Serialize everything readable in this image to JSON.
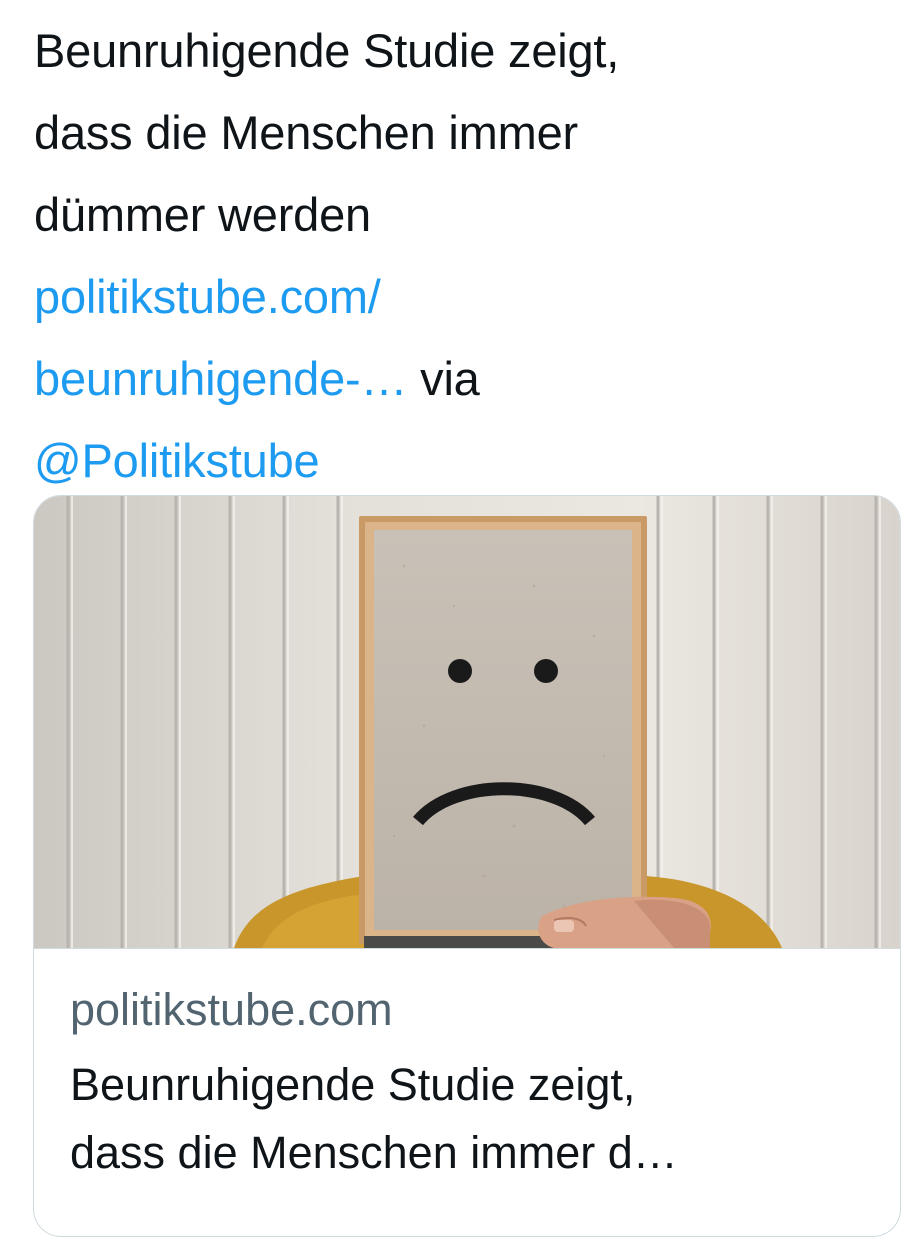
{
  "tweet": {
    "text_line1": "Beunruhigende Studie zeigt,",
    "text_line2": "dass die Menschen immer",
    "text_line3": "dümmer werden",
    "link_line1": "politikstube.com/",
    "link_line2": "beunruhigende-…",
    "via": " via",
    "mention": "@Politikstube"
  },
  "card": {
    "image_icon": "sad-face-frame-photo",
    "domain": "politikstube.com",
    "title_line1": "Beunruhigende Studie zeigt,",
    "title_line2": "dass die Menschen immer d…"
  },
  "colors": {
    "text": "#0f1419",
    "link": "#1d9bf0",
    "secondary": "#536471",
    "border": "#cfd9de"
  }
}
